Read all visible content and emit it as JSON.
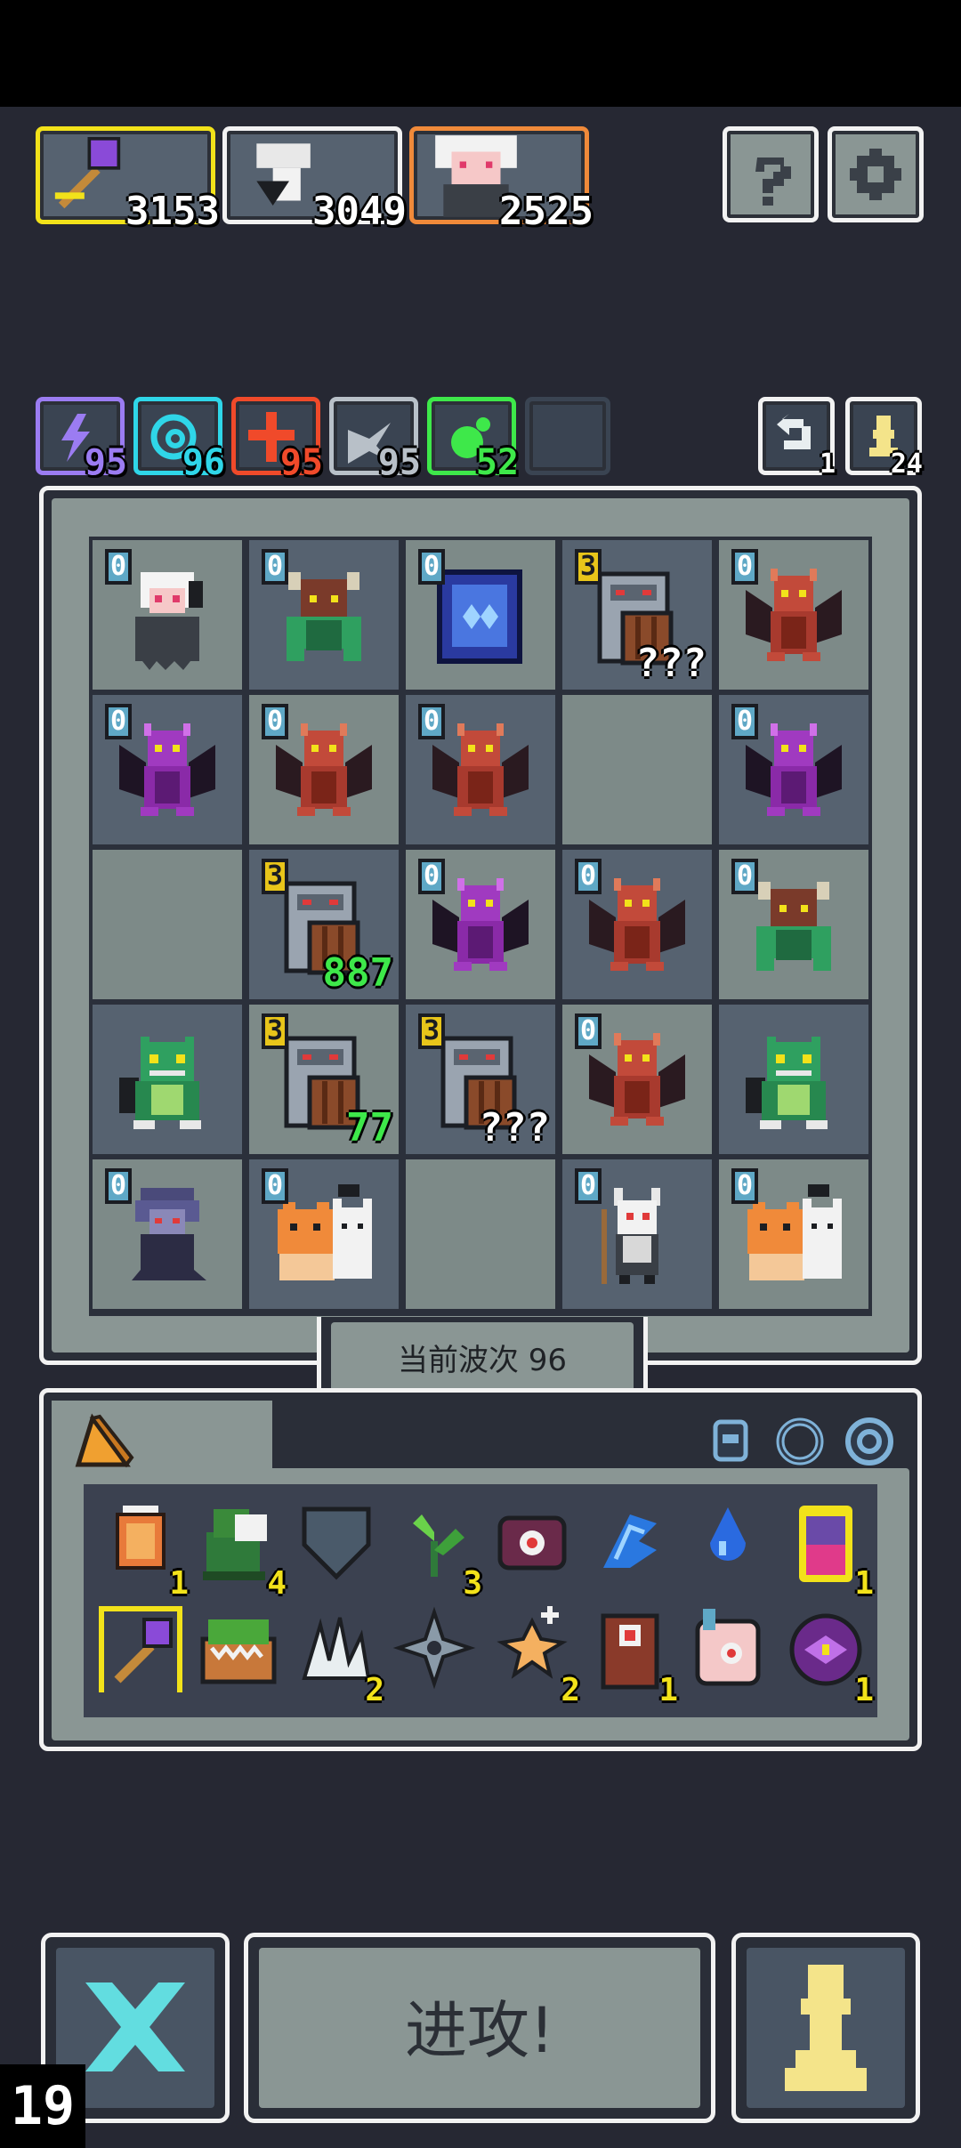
{
  "heroes": [
    {
      "name": "magic-staff",
      "score": "3153",
      "border": "#f2e21a"
    },
    {
      "name": "knight",
      "score": "3049",
      "border": "#f2f2f2"
    },
    {
      "name": "witch",
      "score": "2525",
      "border": "#f08a3a"
    }
  ],
  "top_buttons": {
    "help_icon": "question-icon",
    "settings_icon": "gear-icon"
  },
  "elements": [
    {
      "icon": "lightning-icon",
      "value": "95",
      "color": "#9b7cf2"
    },
    {
      "icon": "swirl-icon",
      "value": "96",
      "color": "#2fd6e8"
    },
    {
      "icon": "fire-icon",
      "value": "95",
      "color": "#f04a2a"
    },
    {
      "icon": "wind-icon",
      "value": "95",
      "color": "#b8c0c8"
    },
    {
      "icon": "poison-icon",
      "value": "52",
      "color": "#3ee84a"
    }
  ],
  "counters": {
    "refresh": "1",
    "pawns": "24"
  },
  "board": {
    "rows": [
      [
        {
          "unit": "ghost-girl",
          "level": "0"
        },
        {
          "unit": "minotaur",
          "level": "0"
        },
        {
          "unit": "blue-cube",
          "level": "0"
        },
        {
          "unit": "shield-tower",
          "level": "3",
          "value": "???"
        },
        {
          "unit": "red-dragon",
          "level": "0"
        }
      ],
      [
        {
          "unit": "purple-dragon",
          "level": "0"
        },
        {
          "unit": "red-dragon",
          "level": "0"
        },
        {
          "unit": "red-dragon",
          "level": "0"
        },
        {
          "unit": "",
          "level": ""
        },
        {
          "unit": "purple-dragon",
          "level": "0"
        }
      ],
      [
        {
          "unit": "",
          "level": ""
        },
        {
          "unit": "shield-tower",
          "level": "3",
          "value": "887"
        },
        {
          "unit": "purple-dragon",
          "level": "0"
        },
        {
          "unit": "red-dragon",
          "level": "0"
        },
        {
          "unit": "minotaur",
          "level": "0"
        }
      ],
      [
        {
          "unit": "green-dino",
          "level": ""
        },
        {
          "unit": "shield-tower",
          "level": "3",
          "value": "77"
        },
        {
          "unit": "shield-tower",
          "level": "3",
          "value": "???"
        },
        {
          "unit": "red-dragon",
          "level": "0"
        },
        {
          "unit": "green-dino",
          "level": ""
        }
      ],
      [
        {
          "unit": "shadow-witch",
          "level": "0"
        },
        {
          "unit": "lion-cat-duo",
          "level": "0"
        },
        {
          "unit": "",
          "level": ""
        },
        {
          "unit": "skeleton-shaman",
          "level": "0"
        },
        {
          "unit": "lion-cat-duo",
          "level": "0"
        }
      ]
    ]
  },
  "wave": {
    "label": "当前波次 96"
  },
  "inventory": {
    "tab_icon": "cheese-icon",
    "filter_icons": [
      "helmet-icon",
      "ring-icon",
      "gear-ring-icon"
    ],
    "items": [
      {
        "icon": "lantern-icon",
        "count": "1"
      },
      {
        "icon": "green-knight-icon",
        "count": "4"
      },
      {
        "icon": "shield-icon",
        "count": ""
      },
      {
        "icon": "plant-icon",
        "count": "3"
      },
      {
        "icon": "eye-gem-icon",
        "count": ""
      },
      {
        "icon": "blue-wing-icon",
        "count": ""
      },
      {
        "icon": "water-drop-icon",
        "count": ""
      },
      {
        "icon": "potion-jar-icon",
        "count": "1"
      },
      {
        "icon": "magic-staff-icon",
        "count": ""
      },
      {
        "icon": "mimic-chest-icon",
        "count": ""
      },
      {
        "icon": "claw-icon",
        "count": "2"
      },
      {
        "icon": "shuriken-icon",
        "count": ""
      },
      {
        "icon": "spark-plus-icon",
        "count": "2"
      },
      {
        "icon": "totem-icon",
        "count": "1"
      },
      {
        "icon": "eye-hand-icon",
        "count": ""
      },
      {
        "icon": "purple-orb-icon",
        "count": "1"
      }
    ]
  },
  "bottom": {
    "close_icon": "cross-icon",
    "attack_label": "进攻!",
    "pawn_icon": "pawn-icon"
  },
  "fps": "19"
}
